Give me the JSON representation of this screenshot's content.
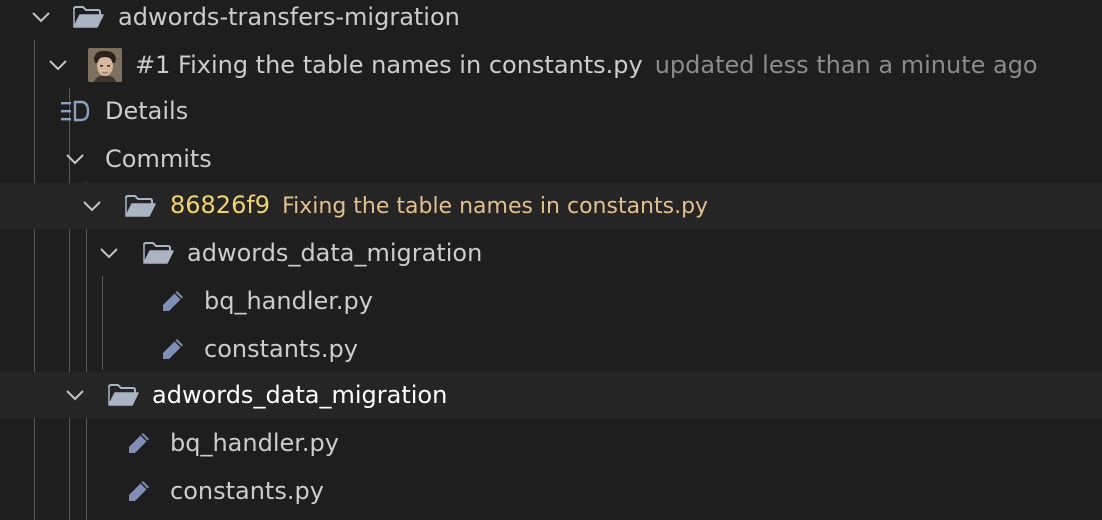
{
  "tree": {
    "repo": {
      "label": "adwords-transfers-migration"
    },
    "pull_request": {
      "title": "#1 Fixing the table names in constants.py",
      "updated": "updated less than a minute ago"
    },
    "details": {
      "label": "Details"
    },
    "commits": {
      "label": "Commits"
    },
    "commit": {
      "hash": "86826f9",
      "message": "Fixing the table names in constants.py"
    },
    "commit_folder": {
      "label": "adwords_data_migration",
      "files": [
        {
          "label": "bq_handler.py"
        },
        {
          "label": "constants.py"
        }
      ]
    },
    "changes_folder": {
      "label": "adwords_data_migration",
      "files": [
        {
          "label": "bq_handler.py"
        },
        {
          "label": "constants.py"
        }
      ]
    }
  },
  "colors": {
    "background": "#1e1e1e",
    "row_highlight": "#252526",
    "text": "#cccccc",
    "description": "#8b8b8b",
    "modified": "#e2c08d",
    "icon": "#8aa0be"
  },
  "icons": {
    "chevron": "chevron-down-icon",
    "folder": "folder-open-icon",
    "details": "details-list-icon",
    "file": "pencil-edit-icon"
  }
}
